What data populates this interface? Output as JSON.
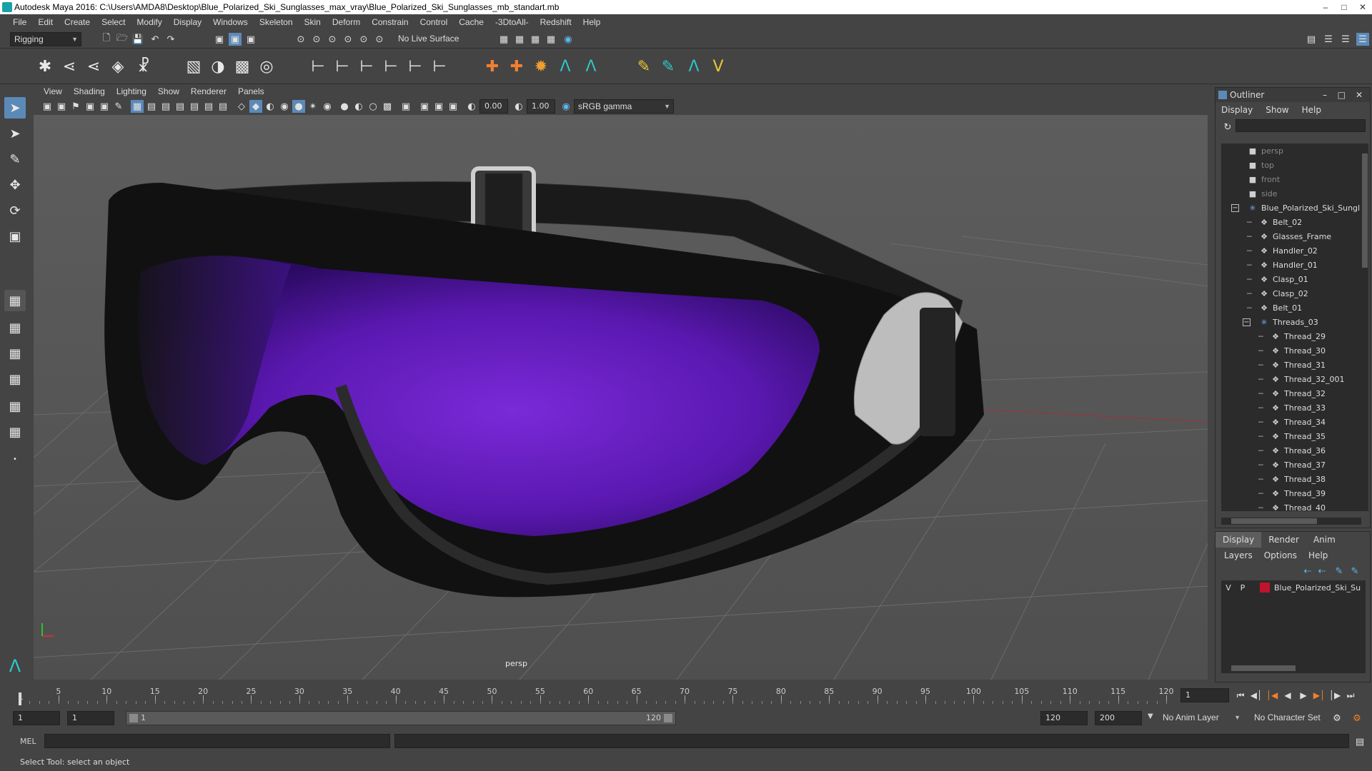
{
  "window": {
    "title": "Autodesk Maya 2016: C:\\Users\\AMDA8\\Desktop\\Blue_Polarized_Ski_Sunglasses_max_vray\\Blue_Polarized_Ski_Sunglasses_mb_standart.mb"
  },
  "menubar": [
    "File",
    "Edit",
    "Create",
    "Select",
    "Modify",
    "Display",
    "Windows",
    "Skeleton",
    "Skin",
    "Deform",
    "Constrain",
    "Control",
    "Cache",
    "-3DtoAll-",
    "Redshift",
    "Help"
  ],
  "statusline": {
    "mode": "Rigging",
    "live_surface": "No Live Surface"
  },
  "viewport": {
    "menu": [
      "View",
      "Shading",
      "Lighting",
      "Show",
      "Renderer",
      "Panels"
    ],
    "near_value": "0.00",
    "far_value": "1.00",
    "color_space": "sRGB gamma",
    "camera_label": "persp",
    "colors": {
      "lens": "#6a1ec8",
      "frame": "#111111"
    }
  },
  "outliner": {
    "title": "Outliner",
    "menu": [
      "Display",
      "Show",
      "Help"
    ],
    "items": [
      {
        "label": "persp",
        "type": "camera",
        "depth": 0
      },
      {
        "label": "top",
        "type": "camera",
        "depth": 0
      },
      {
        "label": "front",
        "type": "camera",
        "depth": 0
      },
      {
        "label": "side",
        "type": "camera",
        "depth": 0
      },
      {
        "label": "Blue_Polarized_Ski_Sungl",
        "type": "group",
        "depth": 0,
        "expanded": true
      },
      {
        "label": "Belt_02",
        "type": "mesh",
        "depth": 1
      },
      {
        "label": "Glasses_Frame",
        "type": "mesh",
        "depth": 1
      },
      {
        "label": "Handler_02",
        "type": "mesh",
        "depth": 1
      },
      {
        "label": "Handler_01",
        "type": "mesh",
        "depth": 1
      },
      {
        "label": "Clasp_01",
        "type": "mesh",
        "depth": 1
      },
      {
        "label": "Clasp_02",
        "type": "mesh",
        "depth": 1
      },
      {
        "label": "Belt_01",
        "type": "mesh",
        "depth": 1
      },
      {
        "label": "Threads_03",
        "type": "group",
        "depth": 1,
        "expanded": true
      },
      {
        "label": "Thread_29",
        "type": "mesh",
        "depth": 2
      },
      {
        "label": "Thread_30",
        "type": "mesh",
        "depth": 2
      },
      {
        "label": "Thread_31",
        "type": "mesh",
        "depth": 2
      },
      {
        "label": "Thread_32_001",
        "type": "mesh",
        "depth": 2
      },
      {
        "label": "Thread_32",
        "type": "mesh",
        "depth": 2
      },
      {
        "label": "Thread_33",
        "type": "mesh",
        "depth": 2
      },
      {
        "label": "Thread_34",
        "type": "mesh",
        "depth": 2
      },
      {
        "label": "Thread_35",
        "type": "mesh",
        "depth": 2
      },
      {
        "label": "Thread_36",
        "type": "mesh",
        "depth": 2
      },
      {
        "label": "Thread_37",
        "type": "mesh",
        "depth": 2
      },
      {
        "label": "Thread_38",
        "type": "mesh",
        "depth": 2
      },
      {
        "label": "Thread_39",
        "type": "mesh",
        "depth": 2
      },
      {
        "label": "Thread_40",
        "type": "mesh",
        "depth": 2
      }
    ]
  },
  "layers": {
    "tabs": [
      "Display",
      "Render",
      "Anim"
    ],
    "menu": [
      "Layers",
      "Options",
      "Help"
    ],
    "rows": [
      {
        "v": "V",
        "p": "P",
        "color": "#c0142c",
        "name": "Blue_Polarized_Ski_Su"
      }
    ]
  },
  "timeline": {
    "ticks": [
      "5",
      "10",
      "15",
      "20",
      "25",
      "30",
      "35",
      "40",
      "45",
      "50",
      "55",
      "60",
      "65",
      "70",
      "75",
      "80",
      "85",
      "90",
      "95",
      "100",
      "105",
      "110",
      "115",
      "120"
    ],
    "start_label": "1",
    "current_frame": "1"
  },
  "range": {
    "start": "1",
    "playback_start": "1",
    "slider_start": "1",
    "slider_end": "120",
    "playback_end": "120",
    "end": "200",
    "anim_layer": "No Anim Layer",
    "character_set": "No Character Set"
  },
  "cmdline": {
    "label": "MEL"
  },
  "helpline": {
    "text": "Select Tool: select an object"
  }
}
